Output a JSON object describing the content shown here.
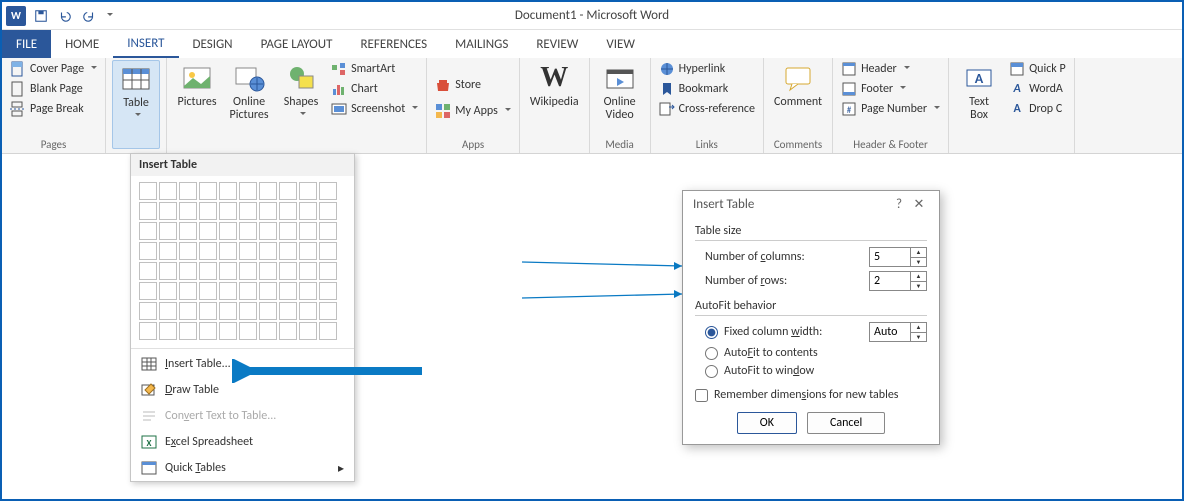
{
  "window": {
    "title": "Document1 - Microsoft Word"
  },
  "tabs": {
    "file": "FILE",
    "home": "HOME",
    "insert": "INSERT",
    "design": "DESIGN",
    "page_layout": "PAGE LAYOUT",
    "references": "REFERENCES",
    "mailings": "MAILINGS",
    "review": "REVIEW",
    "view": "VIEW"
  },
  "ribbon": {
    "pages": {
      "cover_page": "Cover Page",
      "blank_page": "Blank Page",
      "page_break": "Page Break",
      "label": "Pages"
    },
    "tables": {
      "table": "Table"
    },
    "illustrations": {
      "pictures": "Pictures",
      "online_pictures": "Online\nPictures",
      "shapes": "Shapes",
      "smartart": "SmartArt",
      "chart": "Chart",
      "screenshot": "Screenshot"
    },
    "apps": {
      "store": "Store",
      "my_apps": "My Apps",
      "label": "Apps"
    },
    "wikipedia": "Wikipedia",
    "media": {
      "online_video": "Online\nVideo",
      "label": "Media"
    },
    "links": {
      "hyperlink": "Hyperlink",
      "bookmark": "Bookmark",
      "cross_reference": "Cross-reference",
      "label": "Links"
    },
    "comments": {
      "comment": "Comment",
      "label": "Comments"
    },
    "header_footer": {
      "header": "Header",
      "footer": "Footer",
      "page_number": "Page Number",
      "label": "Header & Footer"
    },
    "text": {
      "text_box": "Text\nBox",
      "quick_parts": "Quick P",
      "wordart": "WordA",
      "drop_cap": "Drop C"
    }
  },
  "table_menu": {
    "header": "Insert Table",
    "insert_table": "Insert Table...",
    "draw_table": "Draw Table",
    "convert": "Convert Text to Table...",
    "excel": "Excel Spreadsheet",
    "quick_tables": "Quick Tables"
  },
  "dialog": {
    "title": "Insert Table",
    "table_size": "Table size",
    "num_cols_label": "Number of columns:",
    "num_cols": "5",
    "num_rows_label": "Number of rows:",
    "num_rows": "2",
    "autofit": "AutoFit behavior",
    "fixed_width": "Fixed column width:",
    "fixed_width_val": "Auto",
    "autofit_contents": "AutoFit to contents",
    "autofit_window": "AutoFit to window",
    "remember": "Remember dimensions for new tables",
    "ok": "OK",
    "cancel": "Cancel"
  }
}
